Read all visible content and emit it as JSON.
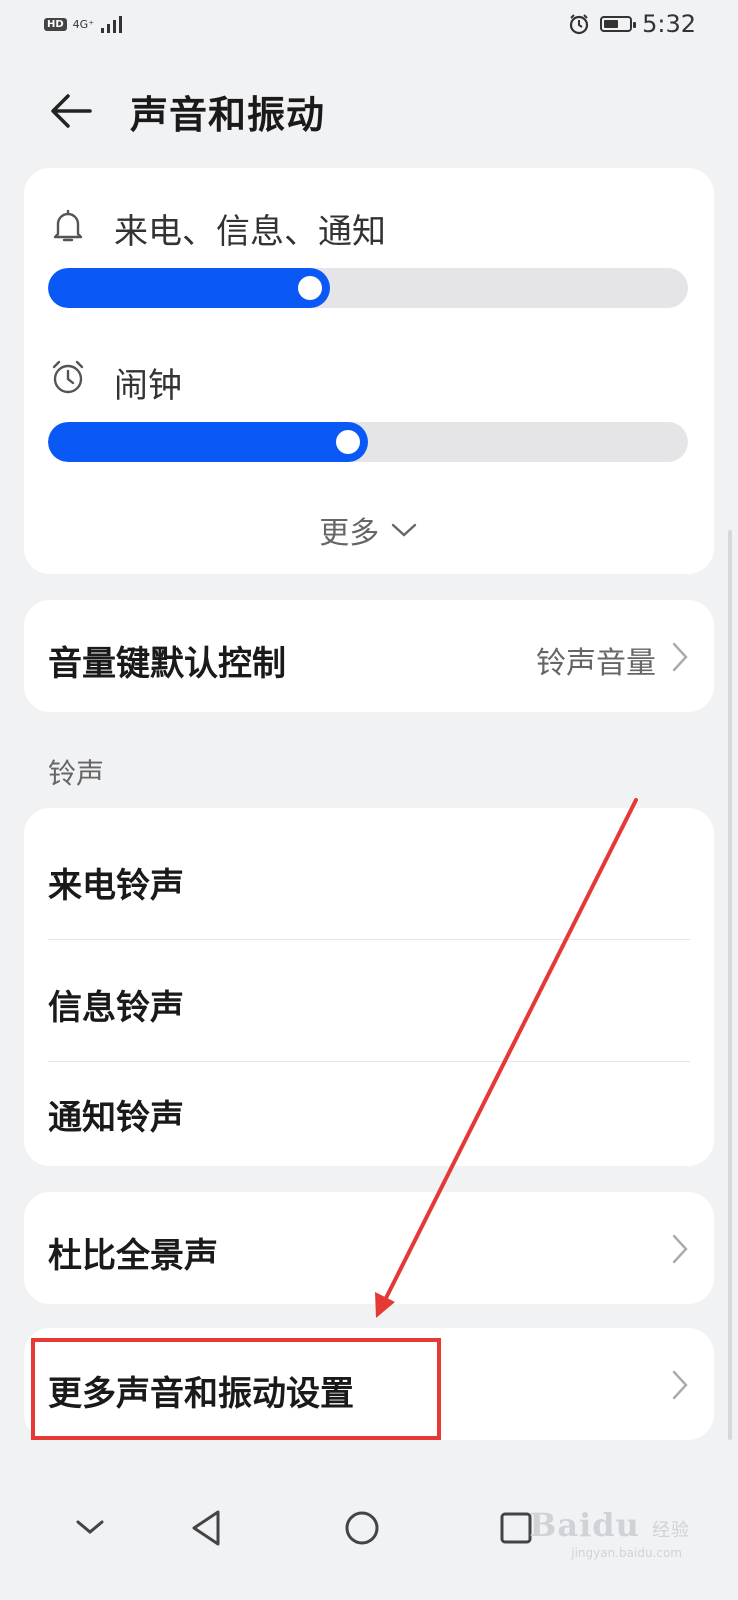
{
  "status_bar": {
    "hd": "HD",
    "network": "4G⁺",
    "time": "5:32",
    "battery_level": 0.6
  },
  "header": {
    "title": "声音和振动",
    "back_icon": "back-arrow-icon"
  },
  "volume": {
    "ring": {
      "label": "来电、信息、通知",
      "icon": "bell-icon",
      "level": 0.44
    },
    "alarm": {
      "label": "闹钟",
      "icon": "alarm-clock-icon",
      "level": 0.5
    },
    "more_label": "更多"
  },
  "volume_key": {
    "label": "音量键默认控制",
    "value": "铃声音量"
  },
  "ringtone_section": {
    "title": "铃声",
    "items": [
      "来电铃声",
      "信息铃声",
      "通知铃声"
    ]
  },
  "dolby": {
    "label": "杜比全景声"
  },
  "more_settings": {
    "label": "更多声音和振动设置"
  },
  "watermark": {
    "brand": "Bai",
    "brand2": "du",
    "suffix": "经验",
    "sub": "jingyan.baidu.com"
  },
  "colors": {
    "accent": "#0a59f7",
    "annotation": "#e53935"
  }
}
